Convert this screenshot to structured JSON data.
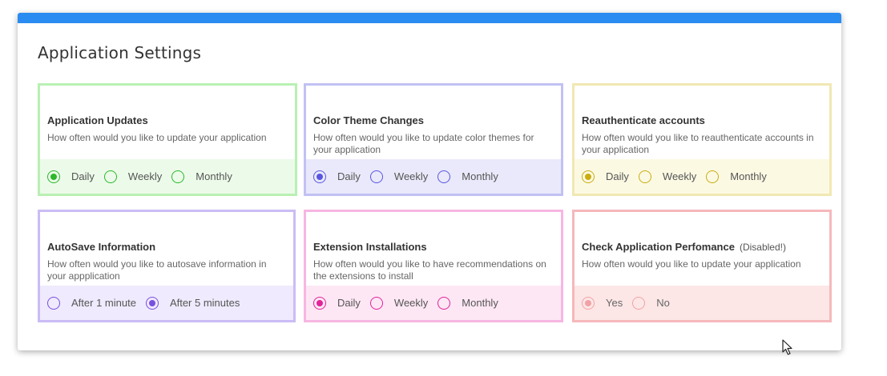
{
  "page": {
    "title": "Application Settings",
    "accent_color": "#2a8cf0"
  },
  "cards": [
    {
      "title": "Application Updates",
      "description": "How often would you like to update your application",
      "border": "#b9f0b3",
      "bg": "#ecfbe9",
      "accent": "#2bb82b",
      "options": [
        {
          "label": "Daily",
          "selected": true
        },
        {
          "label": "Weekly",
          "selected": false
        },
        {
          "label": "Monthly",
          "selected": false
        }
      ]
    },
    {
      "title": "Color Theme Changes",
      "description": "How often would you like to update color themes for your application",
      "border": "#c1c1f3",
      "bg": "#e9e9fb",
      "accent": "#5a55e0",
      "options": [
        {
          "label": "Daily",
          "selected": true
        },
        {
          "label": "Weekly",
          "selected": false
        },
        {
          "label": "Monthly",
          "selected": false
        }
      ]
    },
    {
      "title": "Reauthenticate accounts",
      "description": "How often would you like to reauthenticate accounts in your application",
      "border": "#f1e8b3",
      "bg": "#fcf9e3",
      "accent": "#c9ad12",
      "options": [
        {
          "label": "Daily",
          "selected": true
        },
        {
          "label": "Weekly",
          "selected": false
        },
        {
          "label": "Monthly",
          "selected": false
        }
      ]
    },
    {
      "title": "AutoSave Information",
      "description": "How often would you like to autosave information in your appplication",
      "border": "#cbbcf6",
      "bg": "#efeafd",
      "accent": "#7a4fe0",
      "options": [
        {
          "label": "After 1 minute",
          "selected": false
        },
        {
          "label": "After 5 minutes",
          "selected": true
        }
      ]
    },
    {
      "title": "Extension Installations",
      "description": "How often would you like to have recommendations on the extensions to install",
      "border": "#f7b6e2",
      "bg": "#fde7f4",
      "accent": "#e2229b",
      "options": [
        {
          "label": "Daily",
          "selected": true
        },
        {
          "label": "Weekly",
          "selected": false
        },
        {
          "label": "Monthly",
          "selected": false
        }
      ]
    },
    {
      "title": "Check Application Perfomance",
      "note": "(Disabled!)",
      "disabled": true,
      "description": "How often would you like to update your application",
      "border": "#f6b8bb",
      "bg": "#fde6e6",
      "accent": "#f0a3a6",
      "options": [
        {
          "label": "Yes",
          "selected": true
        },
        {
          "label": "No",
          "selected": false
        }
      ]
    }
  ]
}
